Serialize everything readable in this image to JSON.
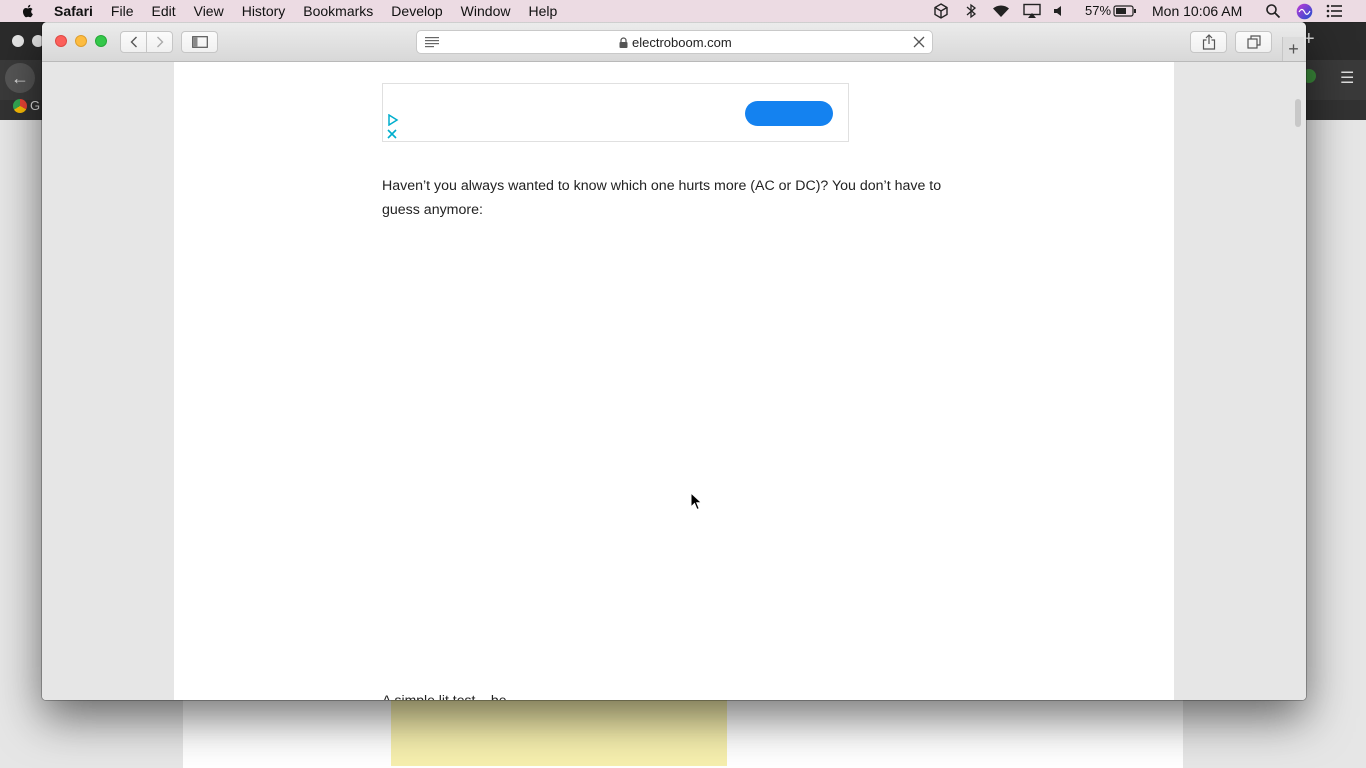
{
  "menubar": {
    "app_name": "Safari",
    "menus": [
      "File",
      "Edit",
      "View",
      "History",
      "Bookmarks",
      "Develop",
      "Window",
      "Help"
    ],
    "battery_percent": "57%",
    "clock": "Mon 10:06 AM",
    "status_icons": [
      "dropbox-icon",
      "bluetooth-icon",
      "wifi-icon",
      "airplay-icon",
      "volume-icon",
      "battery-icon",
      "spotlight-icon",
      "siri-icon",
      "notification-center-icon"
    ]
  },
  "background_app": {
    "bookmark_label": "G"
  },
  "safari": {
    "url": "electroboom.com",
    "new_tab_label": "+"
  },
  "article": {
    "paragraph": "Haven’t you always wanted to know which one hurts more (AC or DC)? You don’t have to guess anymore:",
    "next_line_partial": "A simple lit test... be"
  },
  "colors": {
    "ad_button": "#1482f0",
    "ad_icon": "#00aecd",
    "close": "#fc605b",
    "minimize": "#fdbc40",
    "maximize": "#34c84a"
  }
}
